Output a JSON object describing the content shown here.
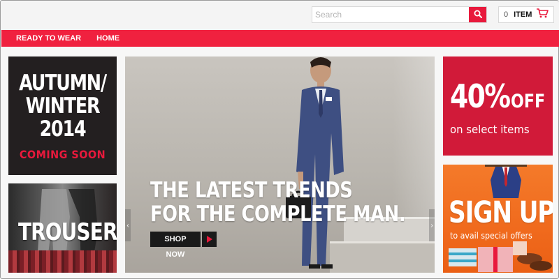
{
  "search": {
    "placeholder": "Search",
    "value": ""
  },
  "cart": {
    "count": "0",
    "label": "ITEM"
  },
  "nav": {
    "items": [
      {
        "label": "READY TO WEAR"
      },
      {
        "label": "HOME"
      }
    ]
  },
  "panels": {
    "autumn": {
      "lines": [
        "AUTUMN/",
        "WINTER",
        "2014"
      ],
      "subtitle": "COMING SOON"
    },
    "trousers": {
      "label": "TROUSERS"
    },
    "hero": {
      "headline_1": "THE LATEST TRENDS",
      "headline_2": "FOR THE COMPLETE MAN.",
      "cta": "SHOP NOW"
    },
    "offer": {
      "percent": "40%",
      "off": "OFF",
      "subtitle": "on select items"
    },
    "signup": {
      "title": "SIGN UP",
      "subtitle": "to avail special offers"
    }
  },
  "colors": {
    "accent": "#f0213f",
    "offer": "#d11a39",
    "signup": "#f06a1d",
    "dark": "#231f20"
  },
  "icons": {
    "search": "search-icon",
    "cart": "cart-icon",
    "prev": "chevron-left-icon",
    "next": "chevron-right-icon",
    "play": "play-icon"
  }
}
